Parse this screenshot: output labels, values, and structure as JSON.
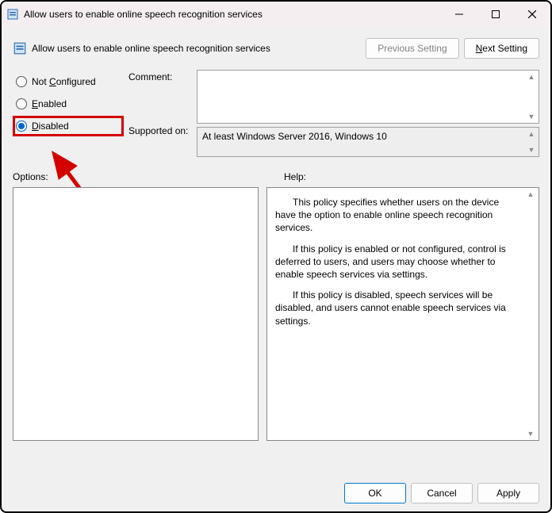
{
  "window": {
    "title": "Allow users to enable online speech recognition services"
  },
  "header": {
    "policy_name": "Allow users to enable online speech recognition services",
    "prev_btn": "Previous Setting",
    "next_btn": "Next Setting"
  },
  "radios": {
    "not_configured": "Not Configured",
    "enabled": "Enabled",
    "disabled": "Disabled",
    "selected": "disabled"
  },
  "labels": {
    "comment": "Comment:",
    "supported_on": "Supported on:",
    "options": "Options:",
    "help": "Help:"
  },
  "fields": {
    "comment_value": "",
    "supported_on_value": "At least Windows Server 2016, Windows 10"
  },
  "help": {
    "p1": "This policy specifies whether users on the device have the option to enable online speech recognition services.",
    "p2": "If this policy is enabled or not configured, control is deferred to users, and users may choose whether to enable speech services via settings.",
    "p3": "If this policy is disabled, speech services will be disabled, and users cannot enable speech services via settings."
  },
  "footer": {
    "ok": "OK",
    "cancel": "Cancel",
    "apply": "Apply"
  }
}
